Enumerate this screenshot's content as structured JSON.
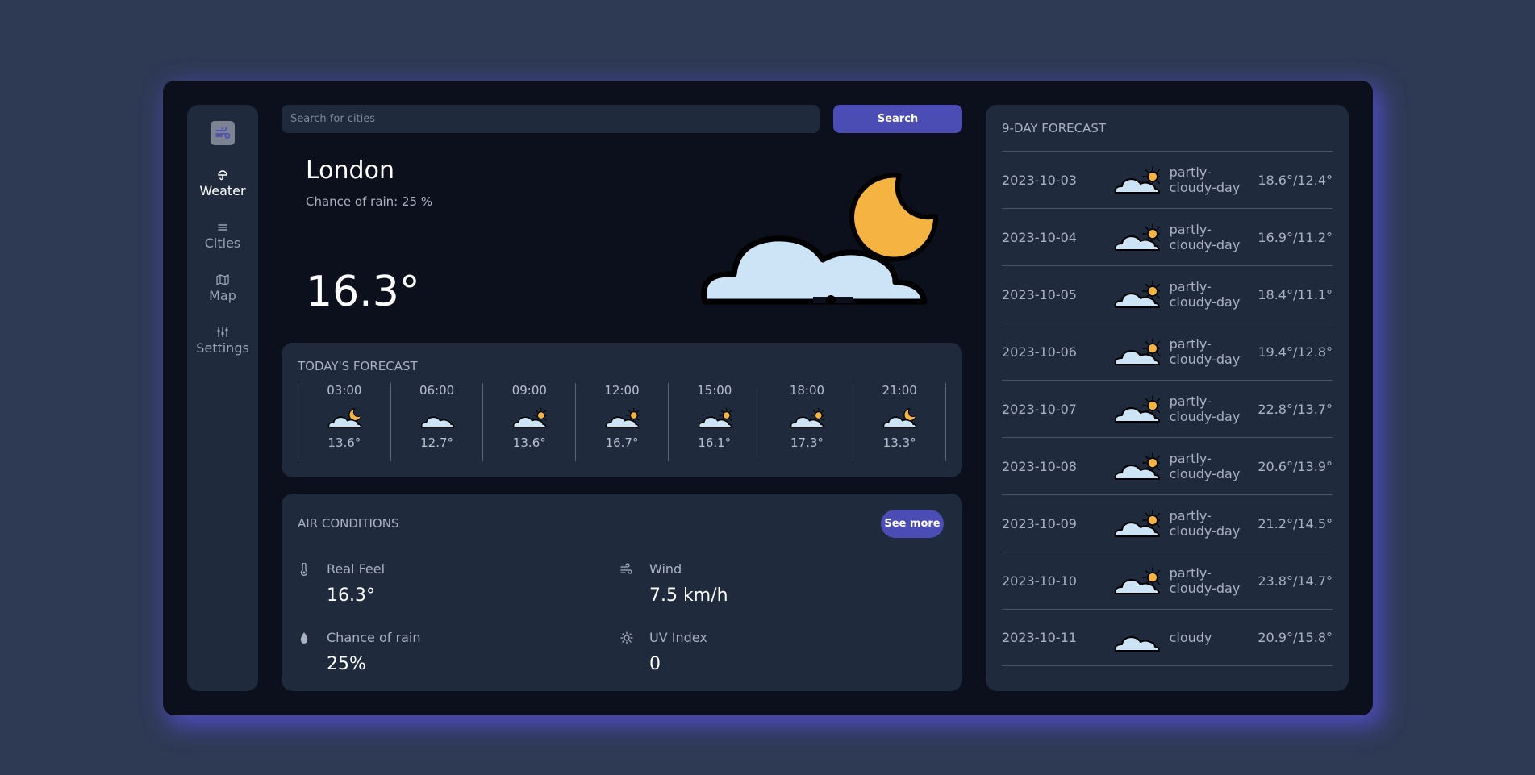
{
  "sidebar": {
    "items": [
      {
        "label": "Weater",
        "icon": "umbrella-icon"
      },
      {
        "label": "Cities",
        "icon": "list-icon"
      },
      {
        "label": "Map",
        "icon": "map-icon"
      },
      {
        "label": "Settings",
        "icon": "sliders-icon"
      }
    ]
  },
  "search": {
    "placeholder": "Search for cities",
    "button_label": "Search"
  },
  "current": {
    "city": "London",
    "rain_chance": "Chance of rain: 25 %",
    "temperature": "16.3°",
    "icon": "partly-cloudy-night-icon"
  },
  "today": {
    "title": "TODAY'S FORECAST",
    "hours": [
      {
        "time": "03:00",
        "temp": "13.6°",
        "icon": "night"
      },
      {
        "time": "06:00",
        "temp": "12.7°",
        "icon": "cloud"
      },
      {
        "time": "09:00",
        "temp": "13.6°",
        "icon": "day"
      },
      {
        "time": "12:00",
        "temp": "16.7°",
        "icon": "day"
      },
      {
        "time": "15:00",
        "temp": "16.1°",
        "icon": "day"
      },
      {
        "time": "18:00",
        "temp": "17.3°",
        "icon": "day"
      },
      {
        "time": "21:00",
        "temp": "13.3°",
        "icon": "night"
      }
    ]
  },
  "air": {
    "title": "AIR CONDITIONS",
    "see_more": "See more",
    "real_feel": {
      "label": "Real Feel",
      "value": "16.3°"
    },
    "wind": {
      "label": "Wind",
      "value": "7.5 km/h"
    },
    "rain": {
      "label": "Chance of rain",
      "value": "25%"
    },
    "uv": {
      "label": "UV Index",
      "value": "0"
    }
  },
  "forecast": {
    "title": "9-DAY FORECAST",
    "days": [
      {
        "date": "2023-10-03",
        "condition": "partly-cloudy-day",
        "temp": "18.6°/12.4°"
      },
      {
        "date": "2023-10-04",
        "condition": "partly-cloudy-day",
        "temp": "16.9°/11.2°"
      },
      {
        "date": "2023-10-05",
        "condition": "partly-cloudy-day",
        "temp": "18.4°/11.1°"
      },
      {
        "date": "2023-10-06",
        "condition": "partly-cloudy-day",
        "temp": "19.4°/12.8°"
      },
      {
        "date": "2023-10-07",
        "condition": "partly-cloudy-day",
        "temp": "22.8°/13.7°"
      },
      {
        "date": "2023-10-08",
        "condition": "partly-cloudy-day",
        "temp": "20.6°/13.9°"
      },
      {
        "date": "2023-10-09",
        "condition": "partly-cloudy-day",
        "temp": "21.2°/14.5°"
      },
      {
        "date": "2023-10-10",
        "condition": "partly-cloudy-day",
        "temp": "23.8°/14.7°"
      },
      {
        "date": "2023-10-11",
        "condition": "cloudy",
        "temp": "20.9°/15.8°"
      }
    ]
  },
  "colors": {
    "background": "#2e3a54",
    "app": "#0b101c",
    "card": "#1f2a3c",
    "accent": "#4b4db5",
    "sun": "#f5b342",
    "cloud": "#cde4f7"
  }
}
